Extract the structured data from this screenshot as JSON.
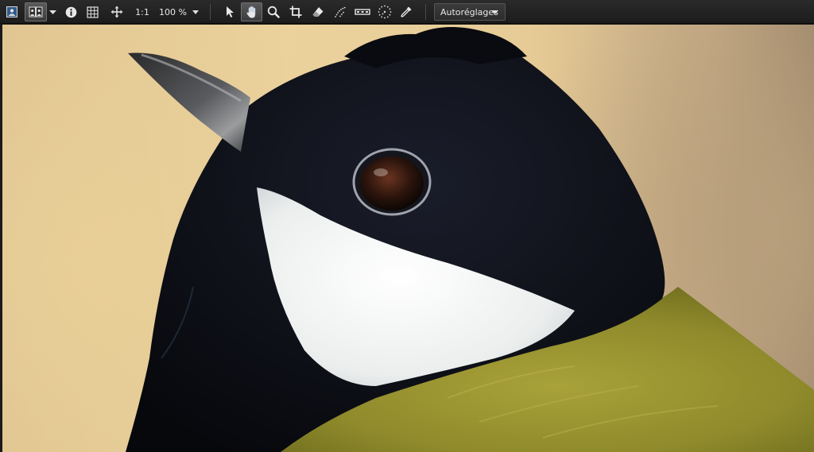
{
  "toolbar": {
    "view_single_icon": "single-view-icon",
    "view_compare_icon": "compare-view-icon",
    "view_mode_dropdown_icon": "caret-down-icon",
    "info_icon": "info-icon",
    "grid_icon": "grid-icon",
    "move_icon": "move-arrows-icon",
    "actual_size_label": "1:1",
    "zoom_label": "100 %",
    "zoom_dropdown_icon": "caret-down-icon",
    "tools": [
      {
        "name": "select-tool",
        "icon": "pointer-arrow-icon",
        "active": false
      },
      {
        "name": "hand-tool",
        "icon": "hand-icon",
        "active": true
      },
      {
        "name": "zoom-tool",
        "icon": "magnifier-icon",
        "active": false
      },
      {
        "name": "crop-tool",
        "icon": "crop-icon",
        "active": false
      },
      {
        "name": "eraser-tool",
        "icon": "eraser-icon",
        "active": false
      },
      {
        "name": "redeye-tool",
        "icon": "dotted-curve-icon",
        "active": false
      },
      {
        "name": "straighten-tool",
        "icon": "straighten-icon",
        "active": false
      },
      {
        "name": "spot-removal-tool",
        "icon": "dotted-circle-icon",
        "active": false
      },
      {
        "name": "eyedropper-tool",
        "icon": "eyedropper-icon",
        "active": false
      }
    ],
    "preset_dropdown": {
      "label": "Autoréglages"
    }
  },
  "viewport": {
    "content": "photo",
    "colors": {
      "background": "#e3c893",
      "black_feathers": "#0b0d14",
      "white_cheek": "#eef0f0",
      "olive_plumage": "#8e8a2a",
      "beak": "#444446"
    }
  }
}
